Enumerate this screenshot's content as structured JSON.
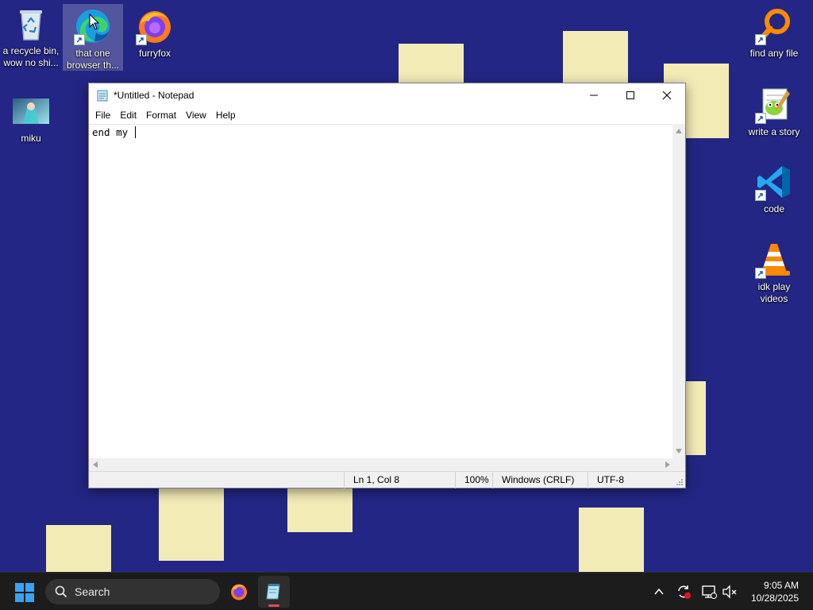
{
  "desktop": {
    "icons": [
      {
        "id": "recycle",
        "label": "a recycle bin, wow no shi..."
      },
      {
        "id": "edge",
        "label": "that one browser th..."
      },
      {
        "id": "firefox",
        "label": "furryfox"
      },
      {
        "id": "miku",
        "label": "miku"
      },
      {
        "id": "everything",
        "label": "find any file"
      },
      {
        "id": "notepadpp",
        "label": "write a story"
      },
      {
        "id": "vscode",
        "label": "code"
      },
      {
        "id": "vlc",
        "label": "idk play videos"
      }
    ]
  },
  "notepad": {
    "title": "*Untitled - Notepad",
    "menu": [
      "File",
      "Edit",
      "Format",
      "View",
      "Help"
    ],
    "content": "end my ",
    "status": {
      "position": "Ln 1, Col 8",
      "zoom": "100%",
      "line_ending": "Windows (CRLF)",
      "encoding": "UTF-8"
    }
  },
  "taskbar": {
    "search_placeholder": "Search",
    "time": "9:05 AM",
    "date": "10/28/2025"
  },
  "colors": {
    "wallpaper": "#232684",
    "sticky_note": "#f3ebb6",
    "taskbar": "#1c1c1c",
    "running_indicator": "#e74856"
  }
}
